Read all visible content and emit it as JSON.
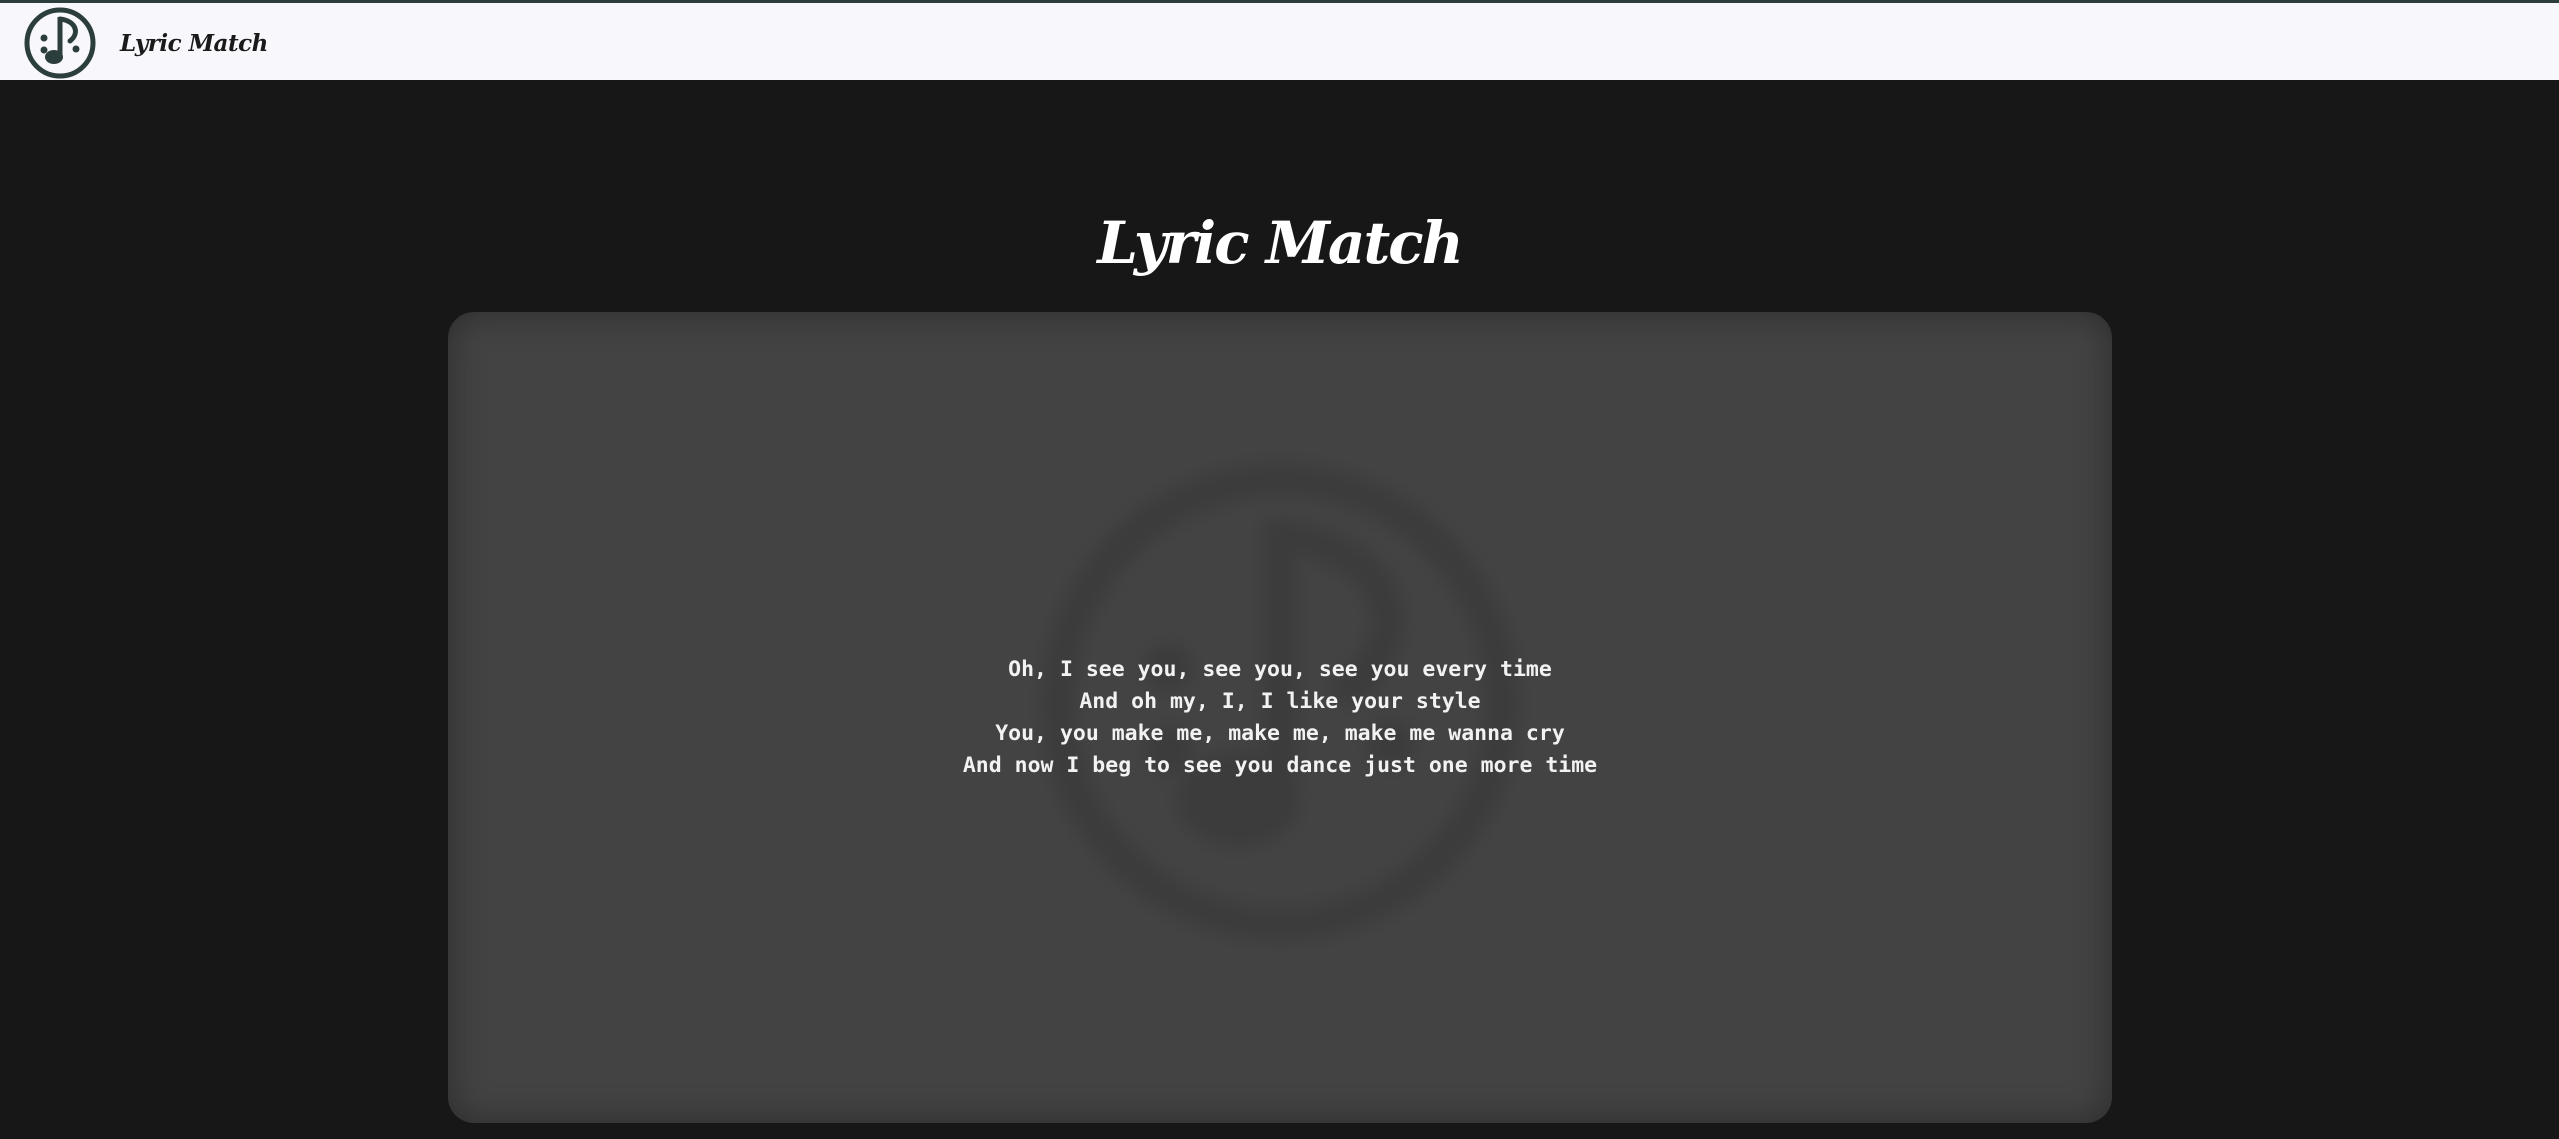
{
  "header": {
    "logo_icon": "music-note-circle-icon",
    "brand": "Lyric Match",
    "background": "#f7f7fc",
    "accent": "#2c3d3d"
  },
  "main": {
    "title": "Lyric Match",
    "card": {
      "background": "#434343",
      "watermark_icon": "music-note-circle-icon",
      "lyrics": [
        "Oh, I see you, see you, see you every time",
        "And oh my, I, I like your style",
        "You, you make me, make me, make me wanna cry",
        "And now I beg to see you dance just one more time"
      ]
    }
  },
  "page_background": "#171717"
}
